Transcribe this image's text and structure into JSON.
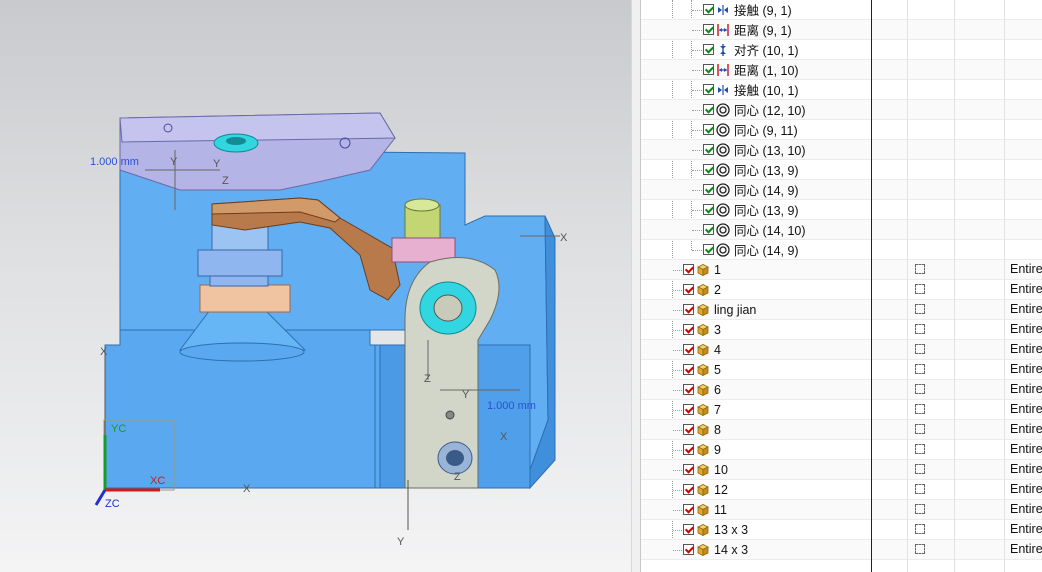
{
  "viewport": {
    "dimensions": [
      "1.000 mm",
      "1.000 mm"
    ],
    "axis_labels": [
      "X",
      "Y",
      "Z",
      "X",
      "Z",
      "X",
      "Y",
      "Z",
      "Y",
      "X",
      "Y"
    ],
    "triad": {
      "yc": "YC",
      "xc": "XC",
      "zc": "ZC"
    }
  },
  "constraints": [
    {
      "type_icon": "touch-align-icon",
      "label": "接触 (9, 1)"
    },
    {
      "type_icon": "distance-icon",
      "label": "距离 (9, 1)"
    },
    {
      "type_icon": "align-icon",
      "label": "对齐 (10, 1)"
    },
    {
      "type_icon": "distance-icon",
      "label": "距离 (1, 10)"
    },
    {
      "type_icon": "touch-align-icon",
      "label": "接触 (10, 1)"
    },
    {
      "type_icon": "concentric-icon",
      "label": "同心 (12, 10)"
    },
    {
      "type_icon": "concentric-icon",
      "label": "同心 (9, 11)"
    },
    {
      "type_icon": "concentric-icon",
      "label": "同心 (13, 10)"
    },
    {
      "type_icon": "concentric-icon",
      "label": "同心 (13, 9)"
    },
    {
      "type_icon": "concentric-icon",
      "label": "同心 (14, 9)"
    },
    {
      "type_icon": "concentric-icon",
      "label": "同心 (13, 9)"
    },
    {
      "type_icon": "concentric-icon",
      "label": "同心 (14, 10)"
    },
    {
      "type_icon": "concentric-icon",
      "label": "同心 (14, 9)"
    }
  ],
  "components": [
    {
      "label": "1",
      "reference": "Entire"
    },
    {
      "label": "2",
      "reference": "Entire"
    },
    {
      "label": "ling jian",
      "reference": "Entire"
    },
    {
      "label": "3",
      "reference": "Entire"
    },
    {
      "label": "4",
      "reference": "Entire"
    },
    {
      "label": "5",
      "reference": "Entire"
    },
    {
      "label": "6",
      "reference": "Entire"
    },
    {
      "label": "7",
      "reference": "Entire"
    },
    {
      "label": "8",
      "reference": "Entire"
    },
    {
      "label": "9",
      "reference": "Entire"
    },
    {
      "label": "10",
      "reference": "Entire"
    },
    {
      "label": "12",
      "reference": "Entire"
    },
    {
      "label": "11",
      "reference": "Entire"
    },
    {
      "label": "13 x 3",
      "reference": "Entire"
    },
    {
      "label": "14 x 3",
      "reference": "Entire"
    }
  ],
  "colors": {
    "base_blue": "#5aa8f0",
    "top_plate": "#b4b4e6",
    "lever": "#b87a4a",
    "link": "#d2d6c8",
    "constraint_check": "#0a8a12",
    "component_check": "#d00000"
  }
}
